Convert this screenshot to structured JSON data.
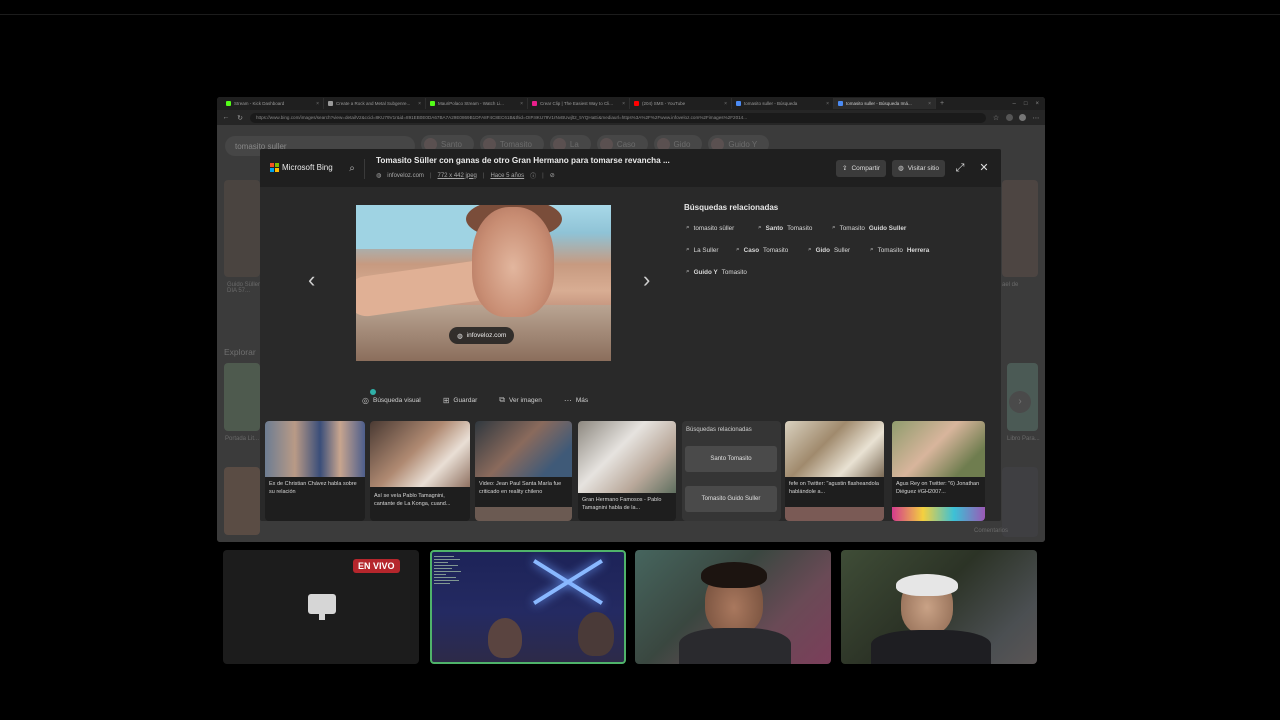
{
  "browser": {
    "tabs": [
      {
        "label": "Stream - Kick Dashboard",
        "favicon_color": "#53fc18",
        "active": false
      },
      {
        "label": "Create a Rock and Metal Subgenre...",
        "favicon_color": "#9a9a9a",
        "active": false
      },
      {
        "label": "MauriPolaco Stream - Watch Li...",
        "favicon_color": "#53fc18",
        "active": false
      },
      {
        "label": "Crear Clip | The Easiest Way to Cli...",
        "favicon_color": "#e91e8c",
        "active": false
      },
      {
        "label": "(204) SMS - YouTube",
        "favicon_color": "#ff0000",
        "active": false
      },
      {
        "label": "tomasito suller - Búsqueda",
        "favicon_color": "#4b8bf4",
        "active": false
      },
      {
        "label": "tomasito suller - Búsqueda Imá...",
        "favicon_color": "#4b8bf4",
        "active": true
      }
    ],
    "url": "https://www.bing.com/images/search?view=detailV2&ccid=8KU79V1r&id=891EB0E0DA67BA7A29E0869B1DFA8F4C8EC61B&thid=OIP.8KU79V1rNvBUwjlt2_5YQHaEi&mediaurl=https%3A%2F%2Fwww.infoveloz.com%2Fimages%2F2014..."
  },
  "background_page": {
    "search_query": "tomasito suller",
    "chips": [
      "Santo",
      "Tomasito",
      "La",
      "Caso",
      "Gido",
      "Guido Y"
    ],
    "explore_label": "Explorar",
    "left_texts": [
      "Guido Süller DIA 57...",
      "Portada Lit..."
    ],
    "right_texts": [
      "ael de",
      "Libro Para..."
    ],
    "bottom_right_text": "Comentarios"
  },
  "modal": {
    "brand": "Microsoft Bing",
    "brand_colors": [
      "#f25022",
      "#7fba00",
      "#00a4ef",
      "#ffb900"
    ],
    "title": "Tomasito Süller con ganas de otro Gran Hermano para tomarse revancha ...",
    "meta": {
      "source": "infoveloz.com",
      "dimensions": "772 x 442 jpeg",
      "age": "Hace 5 años"
    },
    "actions": {
      "share": "Compartir",
      "visit": "Visitar sitio"
    },
    "image_source_chip": "infoveloz.com",
    "tools": [
      {
        "label": "Búsqueda visual",
        "icon": "visual-search-icon"
      },
      {
        "label": "Guardar",
        "icon": "save-icon"
      },
      {
        "label": "Ver imagen",
        "icon": "view-image-icon"
      },
      {
        "label": "Más",
        "icon": "more-icon"
      }
    ],
    "related_title": "Búsquedas relacionadas",
    "related": [
      {
        "normal": "tomasito süller",
        "bold": ""
      },
      {
        "normal": "",
        "bold": "Santo",
        "normal2": " Tomasito"
      },
      {
        "normal": "Tomasito ",
        "bold": "Guido Suller"
      },
      {
        "normal": "La Suller",
        "bold": ""
      },
      {
        "normal": "",
        "bold": "Caso",
        "normal2": " Tomasito"
      },
      {
        "normal": "",
        "bold": "Gido",
        "normal2": " Suller"
      },
      {
        "normal": "Tomasito ",
        "bold": "Herrera"
      },
      {
        "normal": "",
        "bold": "Guido Y",
        "normal2": " Tomasito"
      }
    ],
    "strip": [
      {
        "caption": "Ex de Christian Chávez habla sobre su relación"
      },
      {
        "caption": "Así se veía Pablo Tamagnini, cantante de La Konga, cuand..."
      },
      {
        "caption": "Video: Jean Paul Santa María fue criticado en reality chileno"
      },
      {
        "caption": "Gran Hermano Famosos - Pablo Tamagnini habla de la..."
      },
      {
        "caption": "Búsquedas relacionadas",
        "related": [
          "Santo Tomasito",
          "Tomasito Guido Suller"
        ]
      },
      {
        "caption": "fefe on Twitter: \"agustin flasheandola hablándole a..."
      },
      {
        "caption": "Agus Rey on Twitter: \"6) Jonathan Diéguez #GH2007..."
      }
    ]
  },
  "call": {
    "live_badge": "EN VIVO",
    "active_border_color": "#4fb36a"
  }
}
